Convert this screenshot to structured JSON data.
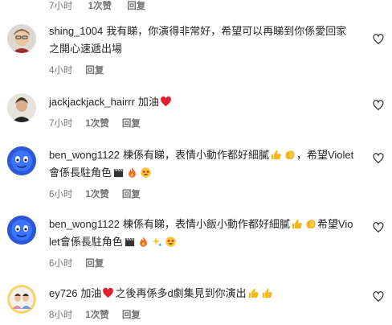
{
  "comments": [
    {
      "username": "shing_1004",
      "text_parts": [
        "我有睇，你演得非常好，希望可以再睇到你係愛回家之開心速遞出場"
      ],
      "time": "4小时",
      "likes": "",
      "reply": "回复",
      "avatar": "user-photo"
    },
    {
      "username": "jackjackjack_hairrr",
      "text_parts": [
        "加油"
      ],
      "emojis": [
        "red-heart"
      ],
      "time": "7小时",
      "likes": "1次赞",
      "reply": "回复",
      "avatar": "user-photo"
    },
    {
      "username": "ben_wong1122",
      "text_parts": [
        "棟係有睇，表情小動作都好細膩",
        "，希望Violet會係長駐角色"
      ],
      "time": "6小时",
      "likes": "1次赞",
      "reply": "回复",
      "avatar": "blue-sphere"
    },
    {
      "username": "ben_wong1122",
      "text_parts": [
        "棟係有睇，表情小飯小動作都好細膩",
        "希望Violet會係長駐角色"
      ],
      "time": "6小时",
      "likes": "",
      "reply": "回复",
      "avatar": "blue-sphere"
    },
    {
      "username": "ey726",
      "text_parts": [
        "加油",
        "之後再係多d劇集見到你演出"
      ],
      "time": "8小时",
      "likes": "1次赞",
      "reply": "回复",
      "avatar": "couple-photo"
    }
  ],
  "colors": {
    "text": "#262626",
    "meta": "#737373",
    "heart": "#ed4956"
  }
}
